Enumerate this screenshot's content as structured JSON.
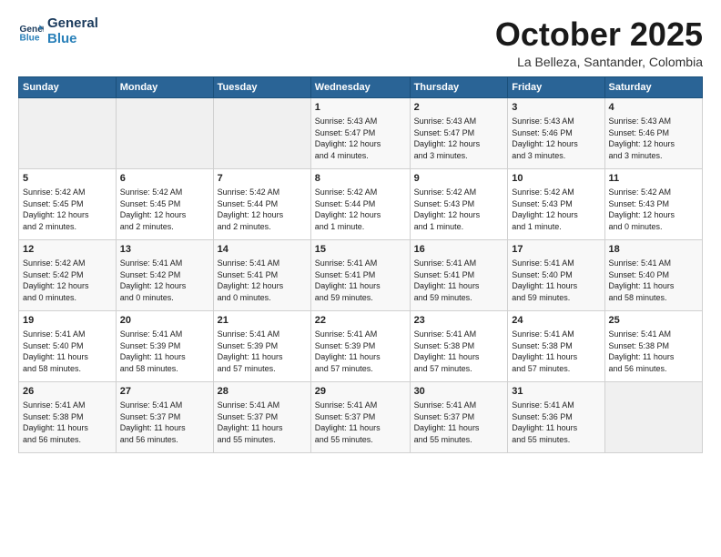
{
  "header": {
    "logo_line1": "General",
    "logo_line2": "Blue",
    "month_title": "October 2025",
    "location": "La Belleza, Santander, Colombia"
  },
  "weekdays": [
    "Sunday",
    "Monday",
    "Tuesday",
    "Wednesday",
    "Thursday",
    "Friday",
    "Saturday"
  ],
  "weeks": [
    [
      {
        "day": "",
        "info": ""
      },
      {
        "day": "",
        "info": ""
      },
      {
        "day": "",
        "info": ""
      },
      {
        "day": "1",
        "info": "Sunrise: 5:43 AM\nSunset: 5:47 PM\nDaylight: 12 hours\nand 4 minutes."
      },
      {
        "day": "2",
        "info": "Sunrise: 5:43 AM\nSunset: 5:47 PM\nDaylight: 12 hours\nand 3 minutes."
      },
      {
        "day": "3",
        "info": "Sunrise: 5:43 AM\nSunset: 5:46 PM\nDaylight: 12 hours\nand 3 minutes."
      },
      {
        "day": "4",
        "info": "Sunrise: 5:43 AM\nSunset: 5:46 PM\nDaylight: 12 hours\nand 3 minutes."
      }
    ],
    [
      {
        "day": "5",
        "info": "Sunrise: 5:42 AM\nSunset: 5:45 PM\nDaylight: 12 hours\nand 2 minutes."
      },
      {
        "day": "6",
        "info": "Sunrise: 5:42 AM\nSunset: 5:45 PM\nDaylight: 12 hours\nand 2 minutes."
      },
      {
        "day": "7",
        "info": "Sunrise: 5:42 AM\nSunset: 5:44 PM\nDaylight: 12 hours\nand 2 minutes."
      },
      {
        "day": "8",
        "info": "Sunrise: 5:42 AM\nSunset: 5:44 PM\nDaylight: 12 hours\nand 1 minute."
      },
      {
        "day": "9",
        "info": "Sunrise: 5:42 AM\nSunset: 5:43 PM\nDaylight: 12 hours\nand 1 minute."
      },
      {
        "day": "10",
        "info": "Sunrise: 5:42 AM\nSunset: 5:43 PM\nDaylight: 12 hours\nand 1 minute."
      },
      {
        "day": "11",
        "info": "Sunrise: 5:42 AM\nSunset: 5:43 PM\nDaylight: 12 hours\nand 0 minutes."
      }
    ],
    [
      {
        "day": "12",
        "info": "Sunrise: 5:42 AM\nSunset: 5:42 PM\nDaylight: 12 hours\nand 0 minutes."
      },
      {
        "day": "13",
        "info": "Sunrise: 5:41 AM\nSunset: 5:42 PM\nDaylight: 12 hours\nand 0 minutes."
      },
      {
        "day": "14",
        "info": "Sunrise: 5:41 AM\nSunset: 5:41 PM\nDaylight: 12 hours\nand 0 minutes."
      },
      {
        "day": "15",
        "info": "Sunrise: 5:41 AM\nSunset: 5:41 PM\nDaylight: 11 hours\nand 59 minutes."
      },
      {
        "day": "16",
        "info": "Sunrise: 5:41 AM\nSunset: 5:41 PM\nDaylight: 11 hours\nand 59 minutes."
      },
      {
        "day": "17",
        "info": "Sunrise: 5:41 AM\nSunset: 5:40 PM\nDaylight: 11 hours\nand 59 minutes."
      },
      {
        "day": "18",
        "info": "Sunrise: 5:41 AM\nSunset: 5:40 PM\nDaylight: 11 hours\nand 58 minutes."
      }
    ],
    [
      {
        "day": "19",
        "info": "Sunrise: 5:41 AM\nSunset: 5:40 PM\nDaylight: 11 hours\nand 58 minutes."
      },
      {
        "day": "20",
        "info": "Sunrise: 5:41 AM\nSunset: 5:39 PM\nDaylight: 11 hours\nand 58 minutes."
      },
      {
        "day": "21",
        "info": "Sunrise: 5:41 AM\nSunset: 5:39 PM\nDaylight: 11 hours\nand 57 minutes."
      },
      {
        "day": "22",
        "info": "Sunrise: 5:41 AM\nSunset: 5:39 PM\nDaylight: 11 hours\nand 57 minutes."
      },
      {
        "day": "23",
        "info": "Sunrise: 5:41 AM\nSunset: 5:38 PM\nDaylight: 11 hours\nand 57 minutes."
      },
      {
        "day": "24",
        "info": "Sunrise: 5:41 AM\nSunset: 5:38 PM\nDaylight: 11 hours\nand 57 minutes."
      },
      {
        "day": "25",
        "info": "Sunrise: 5:41 AM\nSunset: 5:38 PM\nDaylight: 11 hours\nand 56 minutes."
      }
    ],
    [
      {
        "day": "26",
        "info": "Sunrise: 5:41 AM\nSunset: 5:38 PM\nDaylight: 11 hours\nand 56 minutes."
      },
      {
        "day": "27",
        "info": "Sunrise: 5:41 AM\nSunset: 5:37 PM\nDaylight: 11 hours\nand 56 minutes."
      },
      {
        "day": "28",
        "info": "Sunrise: 5:41 AM\nSunset: 5:37 PM\nDaylight: 11 hours\nand 55 minutes."
      },
      {
        "day": "29",
        "info": "Sunrise: 5:41 AM\nSunset: 5:37 PM\nDaylight: 11 hours\nand 55 minutes."
      },
      {
        "day": "30",
        "info": "Sunrise: 5:41 AM\nSunset: 5:37 PM\nDaylight: 11 hours\nand 55 minutes."
      },
      {
        "day": "31",
        "info": "Sunrise: 5:41 AM\nSunset: 5:36 PM\nDaylight: 11 hours\nand 55 minutes."
      },
      {
        "day": "",
        "info": ""
      }
    ]
  ]
}
